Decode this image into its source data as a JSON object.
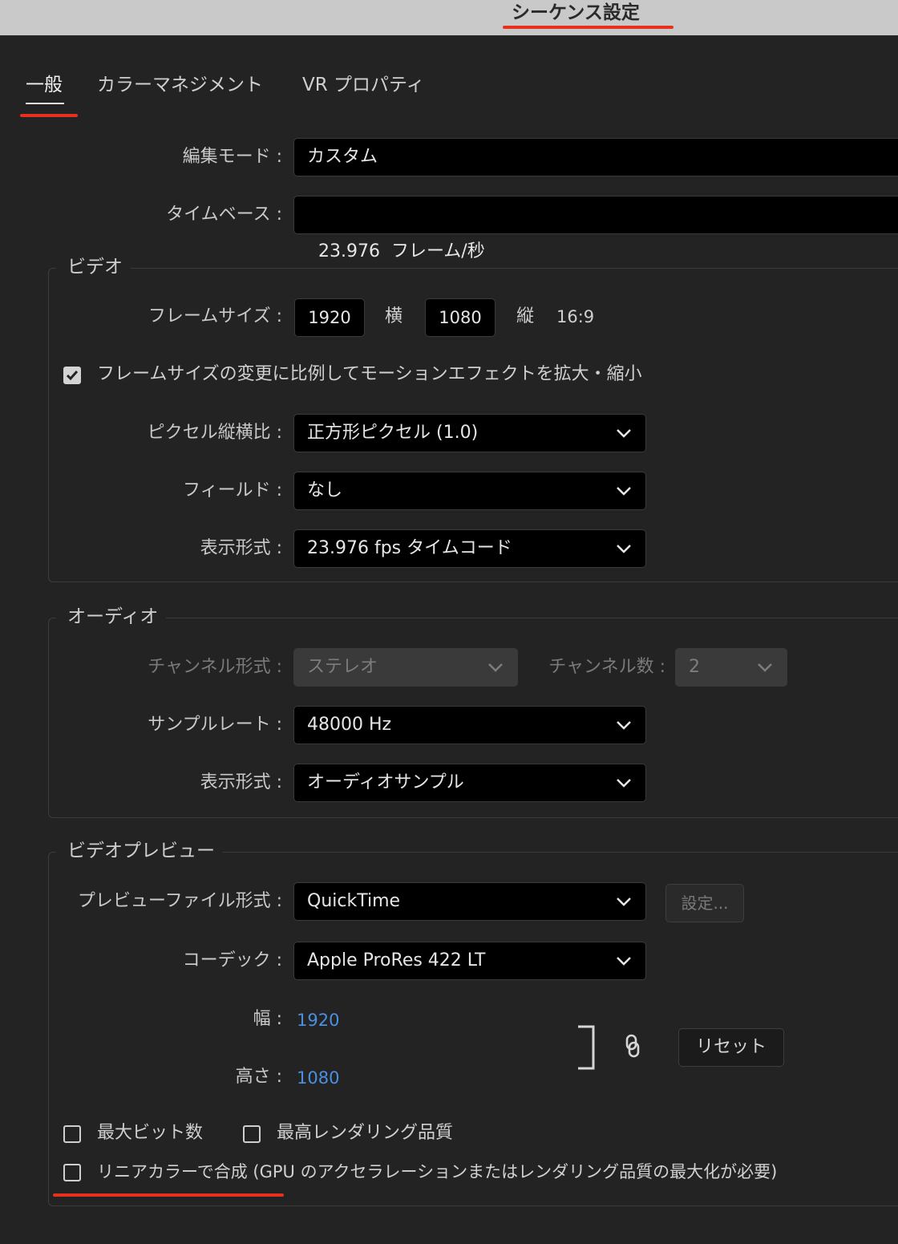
{
  "window": {
    "title": "シーケンス設定"
  },
  "tabs": [
    {
      "label": "一般",
      "active": true
    },
    {
      "label": "カラーマネジメント",
      "active": false
    },
    {
      "label": "VR プロパティ",
      "active": false
    }
  ],
  "general": {
    "edit_mode": {
      "label": "編集モード :",
      "value": "カスタム"
    },
    "timebase": {
      "label": "タイムベース :",
      "value": "23.976  フレーム/秒"
    }
  },
  "video": {
    "legend": "ビデオ",
    "frame_size": {
      "label": "フレームサイズ :",
      "width": "1920",
      "width_unit": "横",
      "height": "1080",
      "height_unit": "縦",
      "aspect": "16:9"
    },
    "scale_checkbox": {
      "label": "フレームサイズの変更に比例してモーションエフェクトを拡大・縮小",
      "checked": true
    },
    "pixel_aspect": {
      "label": "ピクセル縦横比 :",
      "value": "正方形ピクセル (1.0)"
    },
    "fields": {
      "label": "フィールド :",
      "value": "なし"
    },
    "display_format": {
      "label": "表示形式 :",
      "value": "23.976 fps タイムコード"
    }
  },
  "audio": {
    "legend": "オーディオ",
    "channel_format": {
      "label": "チャンネル形式 :",
      "value": "ステレオ",
      "disabled": true
    },
    "channel_count": {
      "label": "チャンネル数 :",
      "value": "2",
      "disabled": true
    },
    "sample_rate": {
      "label": "サンプルレート :",
      "value": "48000 Hz"
    },
    "display_format": {
      "label": "表示形式 :",
      "value": "オーディオサンプル"
    }
  },
  "preview": {
    "legend": "ビデオプレビュー",
    "file_format": {
      "label": "プレビューファイル形式 :",
      "value": "QuickTime"
    },
    "settings_button": "設定...",
    "codec": {
      "label": "コーデック :",
      "value": "Apple ProRes 422 LT"
    },
    "width": {
      "label": "幅 :",
      "value": "1920"
    },
    "height": {
      "label": "高さ :",
      "value": "1080"
    },
    "reset_button": "リセット"
  },
  "options": {
    "max_bit_depth": {
      "label": "最大ビット数",
      "checked": false
    },
    "max_render_quality": {
      "label": "最高レンダリング品質",
      "checked": false
    },
    "linear_color": {
      "label": "リニアカラーで合成 (GPU のアクセラレーションまたはレンダリング品質の最大化が必要)",
      "checked": false
    }
  },
  "colors": {
    "annotation_red": "#e8311c",
    "link_blue": "#4a90e2",
    "background": "#232323"
  }
}
